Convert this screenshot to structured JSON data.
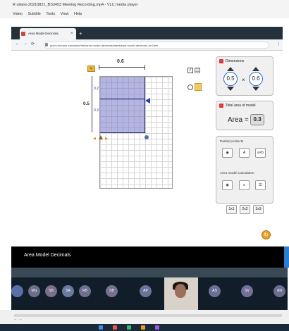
{
  "vlc": {
    "title": "R ultans-20210821_BS3453 Meeting Recording.mp4 - VLC media player",
    "menu": [
      "Video",
      "Subtitle",
      "Tools",
      "View",
      "Help"
    ],
    "time": "-- : --"
  },
  "browser": {
    "tab_title": "Area Model Decimals",
    "tab_close": "×",
    "new_tab": "+",
    "url": "phet.colorado.edu/sims/html/area-model-decimals/latest/area-model-decimals_en.html",
    "nav": [
      "←",
      "→",
      "⟳"
    ]
  },
  "sim": {
    "top_width_label": "0.6",
    "left_height_label": "0.5",
    "sub_label_1": "0.2",
    "sub_label_2": "0.3",
    "pencil": "✎",
    "dimensions": {
      "title": "Dimensions",
      "width": "0.5",
      "times": "×",
      "height": "0.6"
    },
    "total_area": {
      "title": "Total area of model",
      "label": "Area =",
      "value": "0.3"
    },
    "calculation": {
      "partial_products_label": "Partial products",
      "partial_buttons": [
        "",
        "A",
        "a×b"
      ],
      "area_calc_label": "Area model calculation",
      "calc_buttons": [
        "",
        "≡",
        "☰"
      ]
    },
    "multipliers": [
      "1x1",
      "2x2",
      "3x3"
    ],
    "reset": "↻",
    "nav_title": "Area Model Decimals"
  },
  "meeting": {
    "participants": [
      {
        "initials": "",
        "name": "",
        "color": "#5b6fa8"
      },
      {
        "initials": "MG",
        "name": "",
        "color": "#6a6f8a"
      },
      {
        "initials": "SB",
        "name": "",
        "color": "#7b6d8c"
      },
      {
        "initials": "SA",
        "name": "",
        "color": "#6c7aa0"
      },
      {
        "initials": "RB",
        "name": "",
        "color": "#6f6f8f"
      },
      {
        "initials": "SB",
        "name": "",
        "color": "#77718e"
      },
      {
        "initials": "AP",
        "name": "",
        "color": "#6a749a"
      },
      {
        "initials": "AS",
        "name": "",
        "color": "#6d6f92"
      },
      {
        "initials": "SV",
        "name": "",
        "color": "#74709a"
      },
      {
        "initials": "AN",
        "name": "",
        "color": "#6c6e90"
      }
    ]
  },
  "colors": {
    "area_fill": "#7878c8",
    "accent_blue": "#1f3fbf",
    "panel_minus": "#dd3333",
    "reset_orange": "#e8a21e",
    "nav_black": "#000000",
    "strip_dark": "#111d29"
  },
  "icons": {
    "tab_favicon": "phet-favicon-icon",
    "lock": "lock-icon",
    "menu": "menu-dots-icon",
    "grid": "grid-icon",
    "sticky": "sticky-note-icon",
    "eye": "eye-hidden-icon"
  }
}
